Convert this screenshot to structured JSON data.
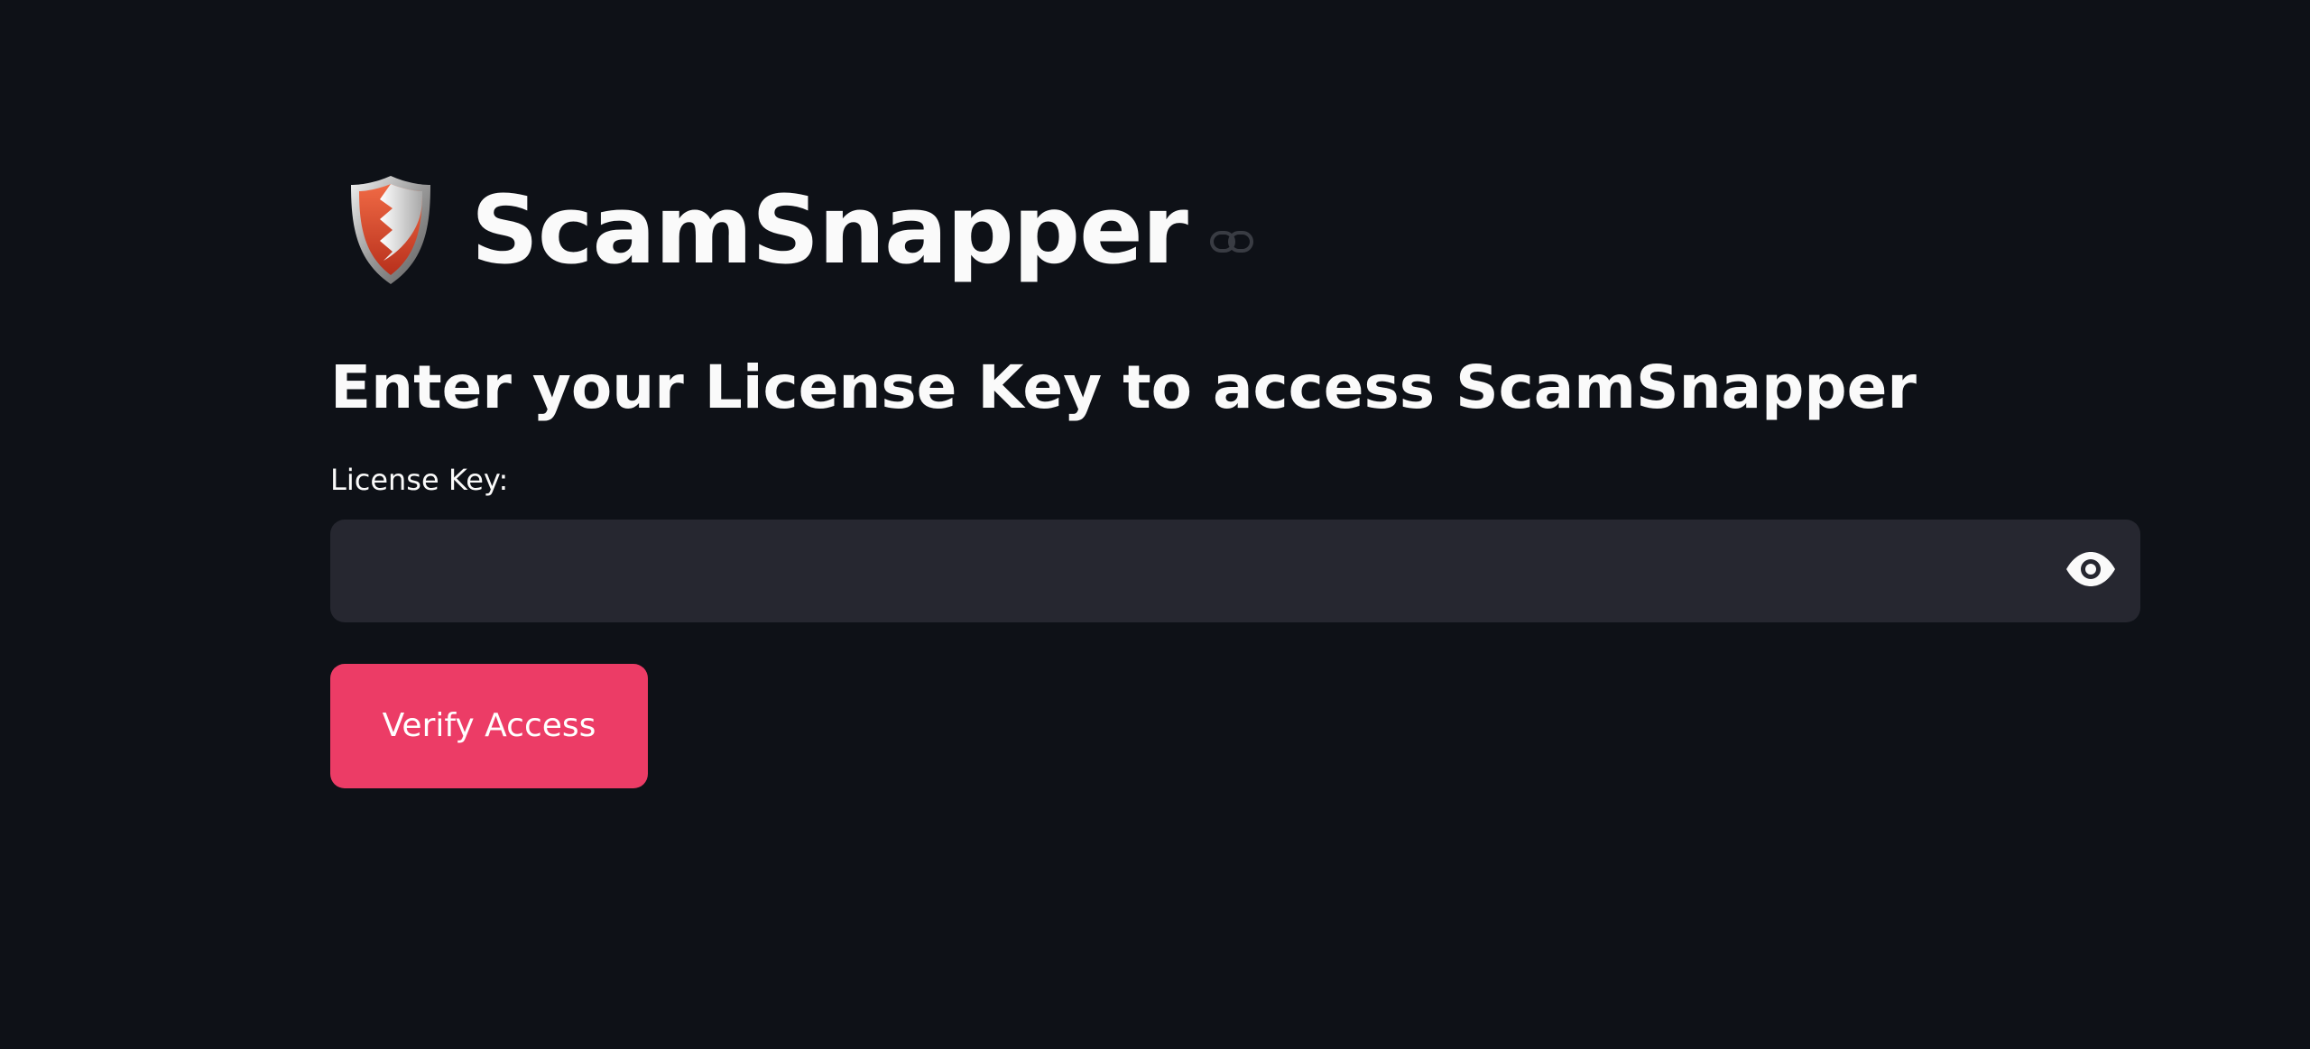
{
  "app": {
    "title": "ScamSnapper",
    "logo_icon": "shield-icon",
    "anchor_icon": "link-icon"
  },
  "auth": {
    "heading": "Enter your License Key to access ScamSnapper",
    "license_label": "License Key:",
    "license_value": "",
    "license_placeholder": "",
    "visibility_icon": "eye-icon",
    "verify_label": "Verify Access"
  },
  "colors": {
    "background": "#0e1117",
    "input_background": "#262730",
    "accent": "#ec3c66",
    "text": "#fafafa"
  }
}
